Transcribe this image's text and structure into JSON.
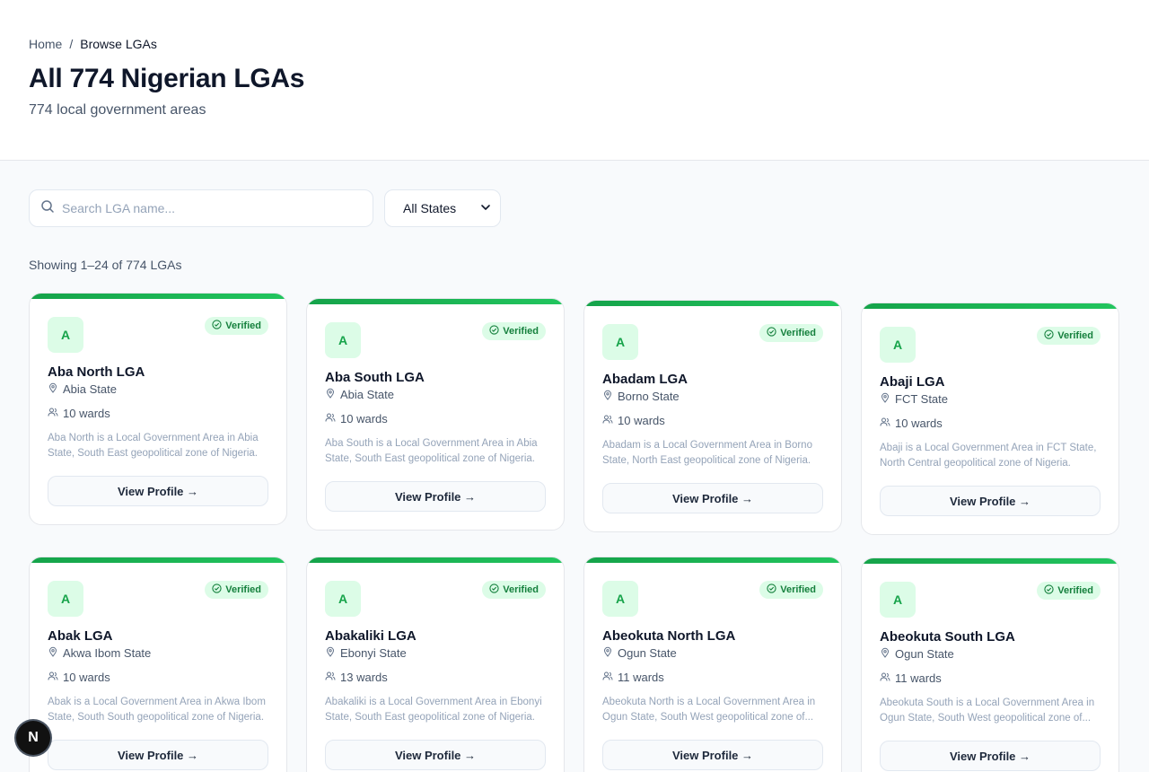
{
  "breadcrumb": {
    "home": "Home",
    "separator": "/",
    "current": "Browse LGAs"
  },
  "header": {
    "title": "All 774 Nigerian LGAs",
    "subtitle": "774 local government areas"
  },
  "search": {
    "placeholder": "Search LGA name...",
    "value": ""
  },
  "state_filter": {
    "selected": "All States"
  },
  "results": {
    "text": "Showing 1–24 of 774 LGAs"
  },
  "colors": {
    "accent": "#16a34a",
    "badge_bg": "#dcfce7"
  },
  "cards": [
    {
      "initial": "A",
      "badge": "Verified",
      "name": "Aba North LGA",
      "state": "Abia State",
      "wards": "10 wards",
      "desc": "Aba North is a Local Government Area in Abia State, South East geopolitical zone of Nigeria.",
      "cta": "View Profile →"
    },
    {
      "initial": "A",
      "badge": "Verified",
      "name": "Aba South LGA",
      "state": "Abia State",
      "wards": "10 wards",
      "desc": "Aba South is a Local Government Area in Abia State, South East geopolitical zone of Nigeria.",
      "cta": "View Profile →"
    },
    {
      "initial": "A",
      "badge": "Verified",
      "name": "Abadam LGA",
      "state": "Borno State",
      "wards": "10 wards",
      "desc": "Abadam is a Local Government Area in Borno State, North East geopolitical zone of Nigeria.",
      "cta": "View Profile →"
    },
    {
      "initial": "A",
      "badge": "Verified",
      "name": "Abaji LGA",
      "state": "FCT State",
      "wards": "10 wards",
      "desc": "Abaji is a Local Government Area in FCT State, North Central geopolitical zone of Nigeria.",
      "cta": "View Profile →"
    },
    {
      "initial": "A",
      "badge": "Verified",
      "name": "Abak LGA",
      "state": "Akwa Ibom State",
      "wards": "10 wards",
      "desc": "Abak is a Local Government Area in Akwa Ibom State, South South geopolitical zone of Nigeria.",
      "cta": "View Profile →"
    },
    {
      "initial": "A",
      "badge": "Verified",
      "name": "Abakaliki LGA",
      "state": "Ebonyi State",
      "wards": "13 wards",
      "desc": "Abakaliki is a Local Government Area in Ebonyi State, South East geopolitical zone of Nigeria.",
      "cta": "View Profile →"
    },
    {
      "initial": "A",
      "badge": "Verified",
      "name": "Abeokuta North LGA",
      "state": "Ogun State",
      "wards": "11 wards",
      "desc": "Abeokuta North is a Local Government Area in Ogun State, South West geopolitical zone of...",
      "cta": "View Profile →"
    },
    {
      "initial": "A",
      "badge": "Verified",
      "name": "Abeokuta South LGA",
      "state": "Ogun State",
      "wards": "11 wards",
      "desc": "Abeokuta South is a Local Government Area in Ogun State, South West geopolitical zone of...",
      "cta": "View Profile →"
    }
  ],
  "dev_badge": {
    "label": "N"
  }
}
